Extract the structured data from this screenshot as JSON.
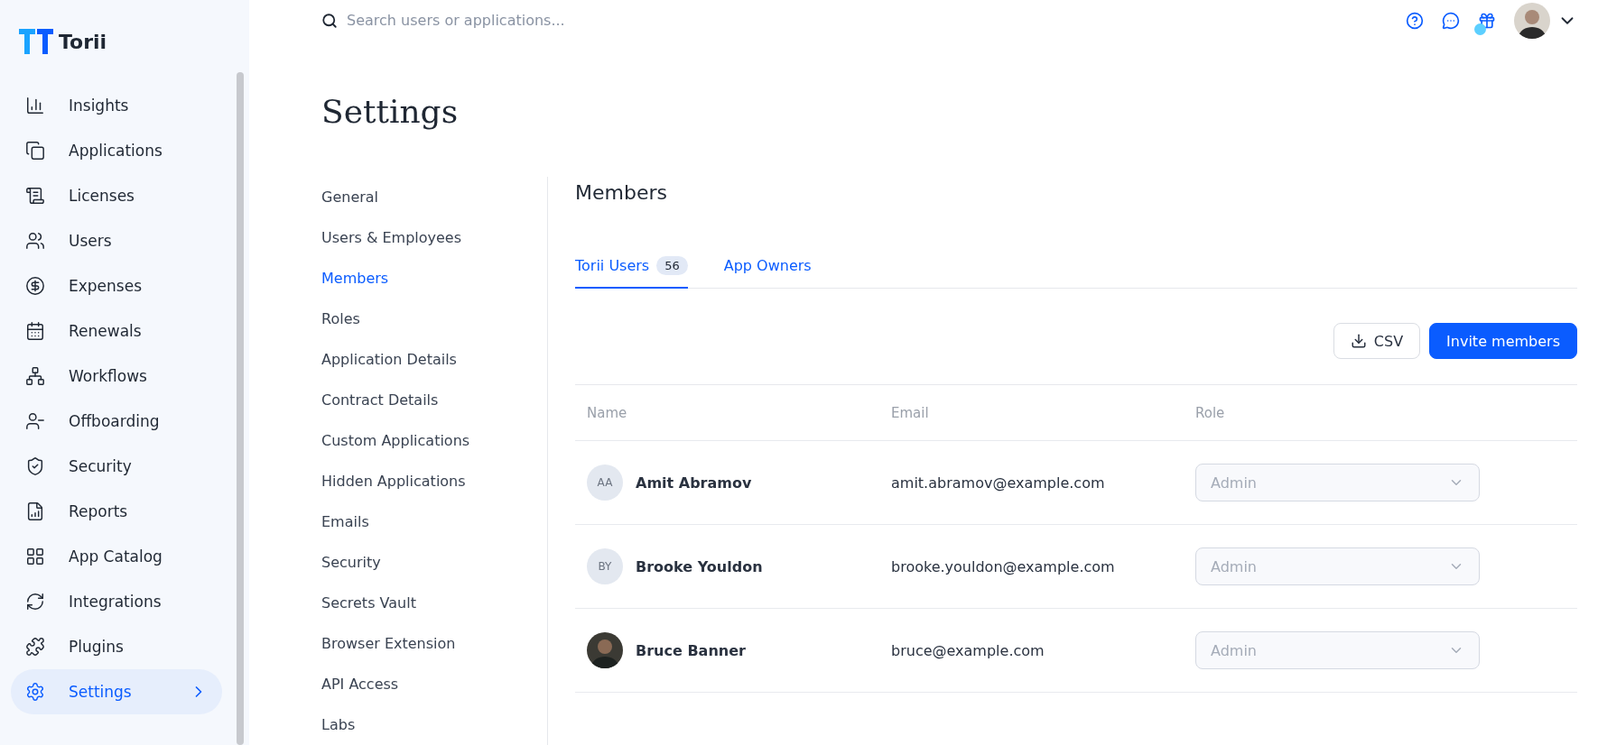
{
  "brand": {
    "name": "Torii"
  },
  "sidebar": {
    "items": [
      {
        "label": "Insights",
        "selected": false
      },
      {
        "label": "Applications",
        "selected": false
      },
      {
        "label": "Licenses",
        "selected": false
      },
      {
        "label": "Users",
        "selected": false
      },
      {
        "label": "Expenses",
        "selected": false
      },
      {
        "label": "Renewals",
        "selected": false
      },
      {
        "label": "Workflows",
        "selected": false
      },
      {
        "label": "Offboarding",
        "selected": false
      },
      {
        "label": "Security",
        "selected": false
      },
      {
        "label": "Reports",
        "selected": false
      },
      {
        "label": "App Catalog",
        "selected": false
      },
      {
        "label": "Integrations",
        "selected": false
      },
      {
        "label": "Plugins",
        "selected": false
      },
      {
        "label": "Settings",
        "selected": true
      }
    ]
  },
  "search": {
    "placeholder": "Search users or applications..."
  },
  "header": {
    "gift_badge": true
  },
  "page": {
    "title": "Settings"
  },
  "settings_nav": {
    "items": [
      {
        "label": "General",
        "selected": false
      },
      {
        "label": "Users & Employees",
        "selected": false
      },
      {
        "label": "Members",
        "selected": true
      },
      {
        "label": "Roles",
        "selected": false
      },
      {
        "label": "Application Details",
        "selected": false
      },
      {
        "label": "Contract Details",
        "selected": false
      },
      {
        "label": "Custom Applications",
        "selected": false
      },
      {
        "label": "Hidden Applications",
        "selected": false
      },
      {
        "label": "Emails",
        "selected": false
      },
      {
        "label": "Security",
        "selected": false
      },
      {
        "label": "Secrets Vault",
        "selected": false
      },
      {
        "label": "Browser Extension",
        "selected": false
      },
      {
        "label": "API Access",
        "selected": false
      },
      {
        "label": "Labs",
        "selected": false
      }
    ]
  },
  "section": {
    "title": "Members"
  },
  "tabs": [
    {
      "label": "Torii Users",
      "count": "56",
      "selected": true
    },
    {
      "label": "App Owners",
      "selected": false
    }
  ],
  "actions": {
    "csv": "CSV",
    "invite": "Invite members"
  },
  "table": {
    "columns": [
      "Name",
      "Email",
      "Role"
    ],
    "rows": [
      {
        "avatar": {
          "kind": "initials",
          "text": "AA"
        },
        "name": "Amit Abramov",
        "email": "amit.abramov@example.com",
        "role": "Admin",
        "disabled": true
      },
      {
        "avatar": {
          "kind": "initials",
          "text": "BY"
        },
        "name": "Brooke Youldon",
        "email": "brooke.youldon@example.com",
        "role": "Admin",
        "disabled": true
      },
      {
        "avatar": {
          "kind": "photo"
        },
        "name": "Bruce Banner",
        "email": "bruce@example.com",
        "role": "Admin",
        "disabled": true
      }
    ]
  }
}
